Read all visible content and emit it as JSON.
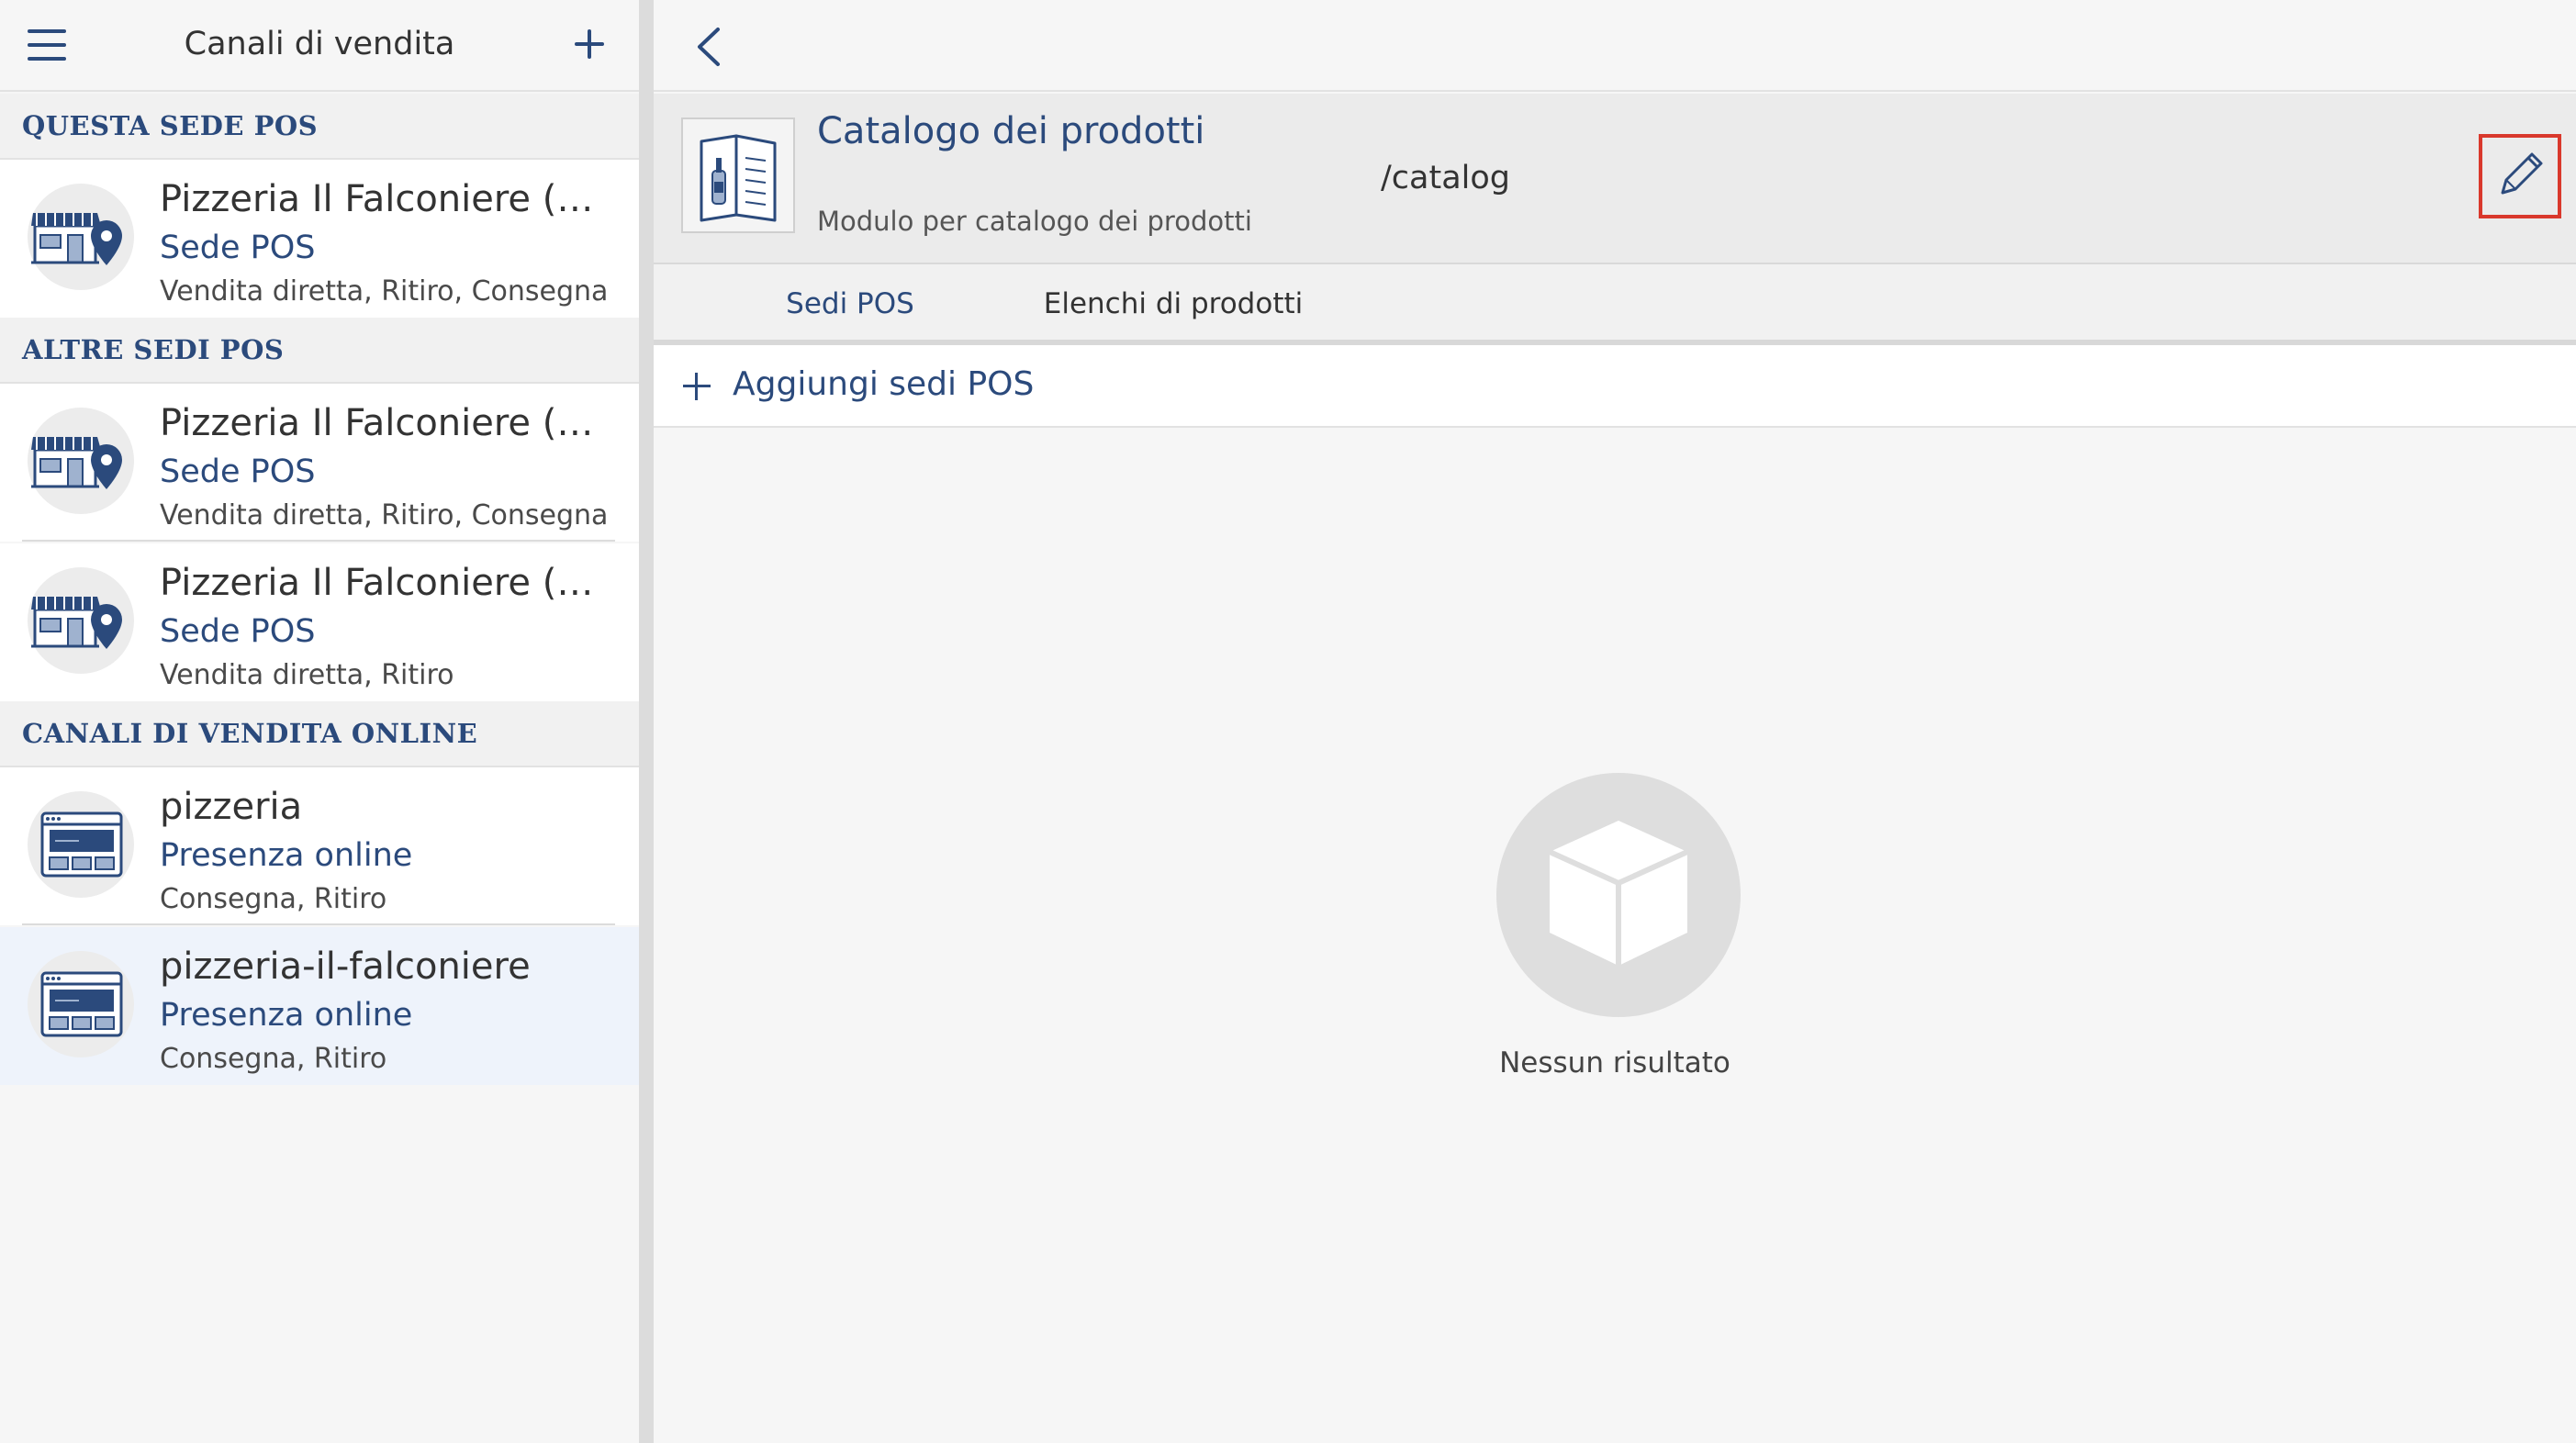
{
  "sidebar": {
    "title": "Canali di vendita",
    "sections": [
      {
        "label": "QUESTA SEDE POS",
        "items": [
          {
            "title": "Pizzeria Il Falconiere (M...",
            "type": "Sede POS",
            "desc": "Vendita diretta, Ritiro, Consegna",
            "icon": "store-location-icon"
          }
        ]
      },
      {
        "label": "ALTRE SEDI POS",
        "items": [
          {
            "title": "Pizzeria Il Falconiere (B...",
            "type": "Sede POS",
            "desc": "Vendita diretta, Ritiro, Consegna",
            "icon": "store-location-icon"
          },
          {
            "title": "Pizzeria Il Falconiere (Ve...",
            "type": "Sede POS",
            "desc": "Vendita diretta, Ritiro",
            "icon": "store-location-icon"
          }
        ]
      },
      {
        "label": "CANALI DI VENDITA ONLINE",
        "items": [
          {
            "title": "pizzeria",
            "type": "Presenza online",
            "desc": "Consegna, Ritiro",
            "icon": "website-icon"
          },
          {
            "title": "pizzeria-il-falconiere",
            "type": "Presenza online",
            "desc": "Consegna, Ritiro",
            "icon": "website-icon",
            "selected": true
          }
        ]
      }
    ]
  },
  "module": {
    "title": "Catalogo dei prodotti",
    "description": "Modulo per catalogo dei prodotti",
    "path": "/catalog",
    "icon": "catalog-menu-icon"
  },
  "tabs": [
    {
      "label": "Sedi POS",
      "active": true
    },
    {
      "label": "Elenchi di prodotti",
      "active": false
    }
  ],
  "add_action": {
    "label": "Aggiungi sedi POS"
  },
  "empty_state": {
    "text": "Nessun risultato",
    "icon": "box-icon"
  },
  "colors": {
    "accent": "#2b4a7c",
    "highlight": "#d9382c",
    "selected_row": "#eef3fb"
  }
}
